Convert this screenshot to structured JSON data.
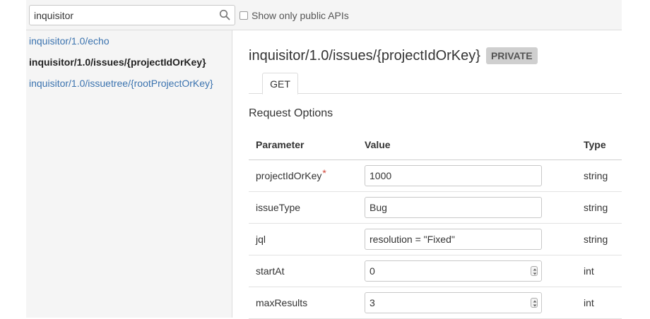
{
  "topbar": {
    "search": {
      "value": "inquisitor",
      "icon": "search-icon"
    },
    "public_toggle": {
      "label": "Show only public APIs",
      "checked": false
    }
  },
  "sidebar": {
    "items": [
      {
        "label": "inquisitor/1.0/echo",
        "active": false
      },
      {
        "label": "inquisitor/1.0/issues/{projectIdOrKey}",
        "active": true
      },
      {
        "label": "inquisitor/1.0/issuetree/{rootProjectOrKey}",
        "active": false
      }
    ]
  },
  "main": {
    "title": "inquisitor/1.0/issues/{projectIdOrKey}",
    "badge": "PRIVATE",
    "tabs": [
      {
        "label": "GET",
        "selected": true
      }
    ],
    "section_title": "Request Options",
    "params_table": {
      "headers": {
        "parameter": "Parameter",
        "value": "Value",
        "type": "Type"
      },
      "rows": [
        {
          "name": "projectIdOrKey",
          "required_mark": "*",
          "value": "1000",
          "type": "string"
        },
        {
          "name": "issueType",
          "value": "Bug",
          "type": "string"
        },
        {
          "name": "jql",
          "value": "resolution = \"Fixed\"",
          "type": "string"
        },
        {
          "name": "startAt",
          "value": "0",
          "type": "int"
        },
        {
          "name": "maxResults",
          "value": "3",
          "type": "int"
        }
      ]
    }
  },
  "colors": {
    "link": "#3b73af",
    "badge_bg": "#cfcfcf",
    "required": "#d04437",
    "sidebar_bg": "#f5f5f5"
  }
}
